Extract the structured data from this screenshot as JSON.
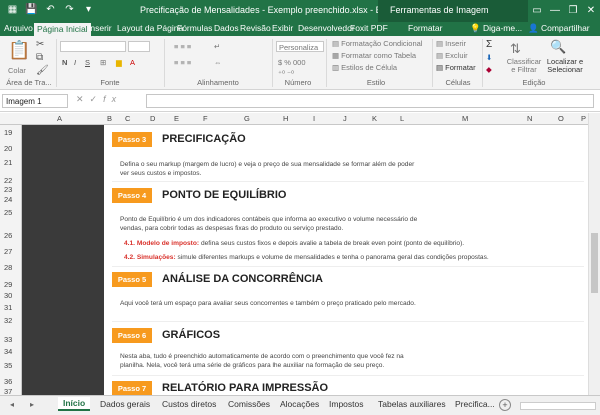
{
  "window": {
    "title": "Precificação de Mensalidades - Exemplo preenchido.xlsx - Excel",
    "context_tab": "Ferramentas de Imagem"
  },
  "ribbon_tabs": [
    "Arquivo",
    "Página Inicial",
    "Inserir",
    "Layout da Página",
    "Fórmulas",
    "Dados",
    "Revisão",
    "Exibir",
    "Desenvolvedor",
    "Foxit PDF",
    "Formatar"
  ],
  "ribbon_help": "Diga-me...",
  "ribbon_share": "Compartilhar",
  "ribbon": {
    "clipboard": {
      "paste": "Colar",
      "label": "Área de Tra..."
    },
    "font": {
      "label": "Fonte"
    },
    "alignment": {
      "label": "Alinhamento"
    },
    "number": {
      "format": "Personaliza",
      "label": "Número"
    },
    "styles": {
      "conditional": "Formatação Condicional",
      "table": "Formatar como Tabela",
      "cell": "Estilos de Célula",
      "label": "Estilo"
    },
    "cells": {
      "insert": "Inserir",
      "delete": "Excluir",
      "format": "Formatar",
      "label": "Células"
    },
    "editing": {
      "sort": "Classificar e Filtrar",
      "find": "Localizar e Selecionar",
      "label": "Edição"
    }
  },
  "formula_bar": {
    "name_box": "Imagem 1",
    "fx": "fx",
    "value": ""
  },
  "columns": [
    "A",
    "B",
    "C",
    "D",
    "E",
    "F",
    "G",
    "H",
    "I",
    "J",
    "K",
    "L",
    "M",
    "N",
    "O",
    "P"
  ],
  "rows": [
    "19",
    "20",
    "21",
    "22",
    "23",
    "24",
    "25",
    "26",
    "27",
    "28",
    "29",
    "30",
    "31",
    "32",
    "33",
    "34",
    "35",
    "36",
    "37"
  ],
  "steps": [
    {
      "badge": "Passo 3",
      "title": "PRECIFICAÇÃO"
    },
    {
      "badge": "Passo 4",
      "title": "PONTO DE EQUILÍBRIO"
    },
    {
      "badge": "Passo 5",
      "title": "ANÁLISE DA CONCORRÊNCIA"
    },
    {
      "badge": "Passo 6",
      "title": "GRÁFICOS"
    },
    {
      "badge": "Passo 7",
      "title": "RELATÓRIO PARA IMPRESSÃO"
    }
  ],
  "paragraphs": {
    "p3": "Defina o seu markup (margem de lucro) e veja o preço de sua mensalidade se formar além de poder ver seus custos e impostos.",
    "p4": "Ponto de Equilíbrio é um dos indicadores contábeis que informa ao executivo o volume necessário de vendas, para cobrir todas as despesas fixas do produto ou serviço prestado.",
    "p4_1_label": "4.1. Modelo de imposto:",
    "p4_1_text": " defina seus custos fixos e depois avalie a tabela de break even point (ponto de equilíbrio).",
    "p4_2_label": "4.2. Simulações:",
    "p4_2_text": " simule diferentes markups e volume de mensalidades e tenha o panorama geral das condições propostas.",
    "p5": "Aqui você terá um espaço para avaliar seus concorrentes e também o preço praticado pelo mercado.",
    "p6": "Nesta aba, tudo é preenchido automaticamente de acordo com o preenchimento que você fez na planilha. Nela, você terá uma série de gráficos para lhe auxiliar na formação de seu preço."
  },
  "sheet_tabs": [
    "Início",
    "Dados gerais",
    "Custos diretos",
    "Comissões",
    "Alocações",
    "Impostos",
    "Tabelas auxiliares",
    "Precifica..."
  ],
  "colors": {
    "excel_green": "#217346",
    "step_orange": "#f79a1e",
    "accent_red": "#d9322c"
  }
}
